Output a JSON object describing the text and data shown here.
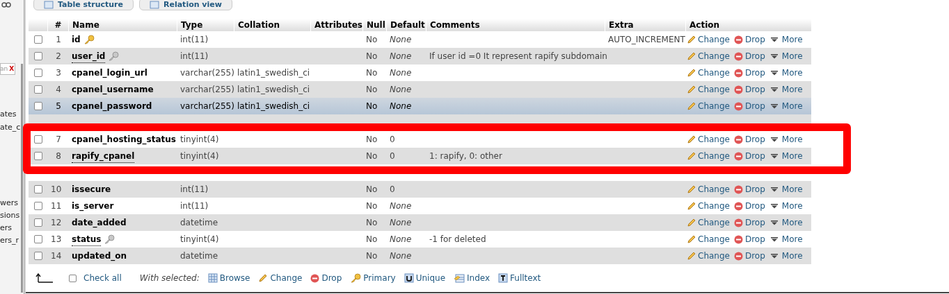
{
  "sidebar": {
    "filter_field": {
      "value": "an",
      "clear": "X"
    },
    "items": [
      {
        "label": "ates"
      },
      {
        "label": "ate_c"
      },
      {
        "label": "wers"
      },
      {
        "label": "sions"
      },
      {
        "label": "ers"
      },
      {
        "label": "ers_r"
      }
    ]
  },
  "tabs": [
    {
      "label": "Table structure",
      "selected": false
    },
    {
      "label": "Relation view",
      "selected": false
    }
  ],
  "table": {
    "columns": [
      "#",
      "Name",
      "Type",
      "Collation",
      "Attributes",
      "Null",
      "Default",
      "Comments",
      "Extra",
      "Action"
    ],
    "rows": [
      {
        "kind": "field",
        "number": "1",
        "checked": false,
        "highlighted": false,
        "name": "id",
        "primary_key": true,
        "indexed": false,
        "has_comment": false,
        "type": "int(11)",
        "null": "No",
        "default": "None",
        "no_default": true,
        "extra": "AUTO_INCREMENT",
        "actions": [
          "Change",
          "Drop",
          "More"
        ]
      },
      {
        "kind": "field",
        "number": "2",
        "checked": false,
        "highlighted": false,
        "name": "user_id",
        "primary_key": false,
        "indexed": true,
        "has_comment": true,
        "type": "int(11)",
        "null": "No",
        "default": "None",
        "no_default": true,
        "comment": "If user id =0 It represent rapify subdomain",
        "actions": [
          "Change",
          "Drop",
          "More"
        ]
      },
      {
        "kind": "field",
        "number": "3",
        "checked": false,
        "highlighted": false,
        "name": "cpanel_login_url",
        "primary_key": false,
        "indexed": false,
        "has_comment": false,
        "type": "varchar(255)",
        "collation": "latin1_swedish_ci",
        "null": "No",
        "default": "None",
        "no_default": true,
        "actions": [
          "Change",
          "Drop",
          "More"
        ]
      },
      {
        "kind": "field",
        "number": "4",
        "checked": false,
        "highlighted": false,
        "name": "cpanel_username",
        "primary_key": false,
        "indexed": false,
        "has_comment": false,
        "type": "varchar(255)",
        "collation": "latin1_swedish_ci",
        "null": "No",
        "default": "None",
        "no_default": true,
        "actions": [
          "Change",
          "Drop",
          "More"
        ]
      },
      {
        "kind": "field",
        "number": "5",
        "checked": false,
        "highlighted": true,
        "name": "cpanel_password",
        "primary_key": false,
        "indexed": false,
        "has_comment": false,
        "type": "varchar(255)",
        "collation": "latin1_swedish_ci",
        "null": "No",
        "default": "None",
        "no_default": true,
        "actions": [
          "Change",
          "Drop",
          "More"
        ]
      },
      {
        "kind": "covered"
      },
      {
        "kind": "field",
        "number": "7",
        "checked": false,
        "highlighted": false,
        "name": "cpanel_hosting_status",
        "primary_key": false,
        "indexed": false,
        "has_comment": false,
        "type": "tinyint(4)",
        "null": "No",
        "default": "0",
        "no_default": false,
        "actions": [
          "Change",
          "Drop",
          "More"
        ]
      },
      {
        "kind": "field",
        "number": "8",
        "checked": false,
        "highlighted": false,
        "name": "rapify_cpanel",
        "primary_key": false,
        "indexed": false,
        "has_comment": true,
        "type": "tinyint(4)",
        "null": "No",
        "default": "0",
        "no_default": false,
        "comment": "1: rapify, 0: other",
        "actions": [
          "Change",
          "Drop",
          "More"
        ]
      },
      {
        "kind": "covered"
      },
      {
        "kind": "field",
        "number": "10",
        "checked": false,
        "highlighted": false,
        "name": "issecure",
        "primary_key": false,
        "indexed": false,
        "has_comment": false,
        "type": "int(11)",
        "null": "No",
        "default": "0",
        "no_default": false,
        "actions": [
          "Change",
          "Drop",
          "More"
        ]
      },
      {
        "kind": "field",
        "number": "11",
        "checked": false,
        "highlighted": false,
        "name": "is_server",
        "primary_key": false,
        "indexed": false,
        "has_comment": false,
        "type": "int(11)",
        "null": "No",
        "default": "None",
        "no_default": true,
        "actions": [
          "Change",
          "Drop",
          "More"
        ]
      },
      {
        "kind": "field",
        "number": "12",
        "checked": false,
        "highlighted": false,
        "name": "date_added",
        "primary_key": false,
        "indexed": false,
        "has_comment": false,
        "type": "datetime",
        "null": "No",
        "default": "None",
        "no_default": true,
        "actions": [
          "Change",
          "Drop",
          "More"
        ]
      },
      {
        "kind": "field",
        "number": "13",
        "checked": false,
        "highlighted": false,
        "name": "status",
        "primary_key": false,
        "indexed": true,
        "has_comment": true,
        "type": "tinyint(4)",
        "null": "No",
        "default": "None",
        "no_default": true,
        "comment": "-1 for deleted",
        "actions": [
          "Change",
          "Drop",
          "More"
        ]
      },
      {
        "kind": "field",
        "number": "14",
        "checked": false,
        "highlighted": false,
        "name": "updated_on",
        "primary_key": false,
        "indexed": false,
        "has_comment": false,
        "type": "datetime",
        "null": "No",
        "default": "None",
        "no_default": true,
        "actions": [
          "Change",
          "Drop",
          "More"
        ]
      }
    ]
  },
  "footer": {
    "check_all": {
      "label": "Check all",
      "checked": false
    },
    "with_selected": "With selected:",
    "actions": [
      {
        "kind": "browse",
        "label": "Browse"
      },
      {
        "kind": "change",
        "label": "Change"
      },
      {
        "kind": "drop",
        "label": "Drop"
      },
      {
        "kind": "primary",
        "label": "Primary"
      },
      {
        "kind": "unique",
        "label": "Unique"
      },
      {
        "kind": "index",
        "label": "Index"
      },
      {
        "kind": "fulltext",
        "label": "Fulltext"
      }
    ]
  }
}
